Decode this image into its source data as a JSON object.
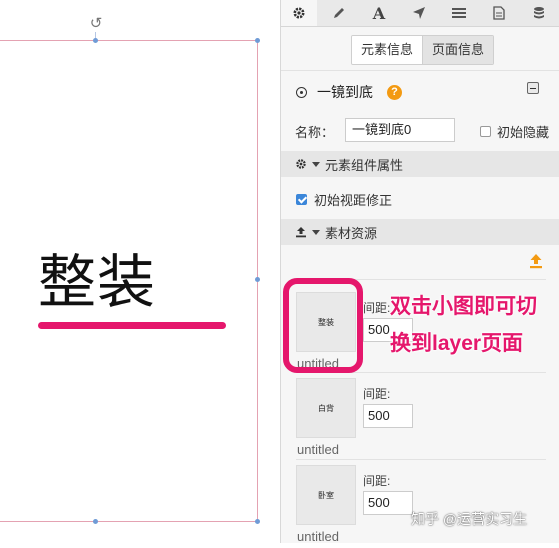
{
  "canvas": {
    "heading": "整装",
    "underline_color": "#e5176c",
    "frame_color": "#e4a2b2",
    "handle_color": "#6f9bd6"
  },
  "toolbar": {
    "tools": [
      {
        "icon": "gear-icon",
        "active": true
      },
      {
        "icon": "pencil-icon",
        "active": false
      },
      {
        "icon": "text-icon",
        "glyph": "A",
        "active": false
      },
      {
        "icon": "send-icon",
        "active": false
      },
      {
        "icon": "list-icon",
        "active": false
      },
      {
        "icon": "document-icon",
        "active": false
      },
      {
        "icon": "database-icon",
        "active": false
      }
    ]
  },
  "tabs": {
    "element_info": "元素信息",
    "page_info": "页面信息"
  },
  "element": {
    "title": "一镜到底",
    "help": "?",
    "name_label": "名称：",
    "name_value": "一镜到底0",
    "hide_label": "初始隐藏",
    "hide_checked": false
  },
  "component_section": {
    "title": "元素组件属性",
    "fix_label": "初始视距修正",
    "fix_checked": true
  },
  "assets_section": {
    "title": "素材资源",
    "items": [
      {
        "name": "untitled",
        "thumb_text": "整装",
        "gap_label": "间距:",
        "gap_value": "500"
      },
      {
        "name": "untitled",
        "thumb_text": "白背",
        "gap_label": "间距:",
        "gap_value": "500"
      },
      {
        "name": "untitled",
        "thumb_text": "卧室",
        "gap_label": "间距:",
        "gap_value": "500"
      }
    ]
  },
  "annotation": {
    "line1": "双击小图即可切",
    "line2": "换到layer页面",
    "color": "#e5176c"
  },
  "watermark": "知乎 @运营实习生"
}
